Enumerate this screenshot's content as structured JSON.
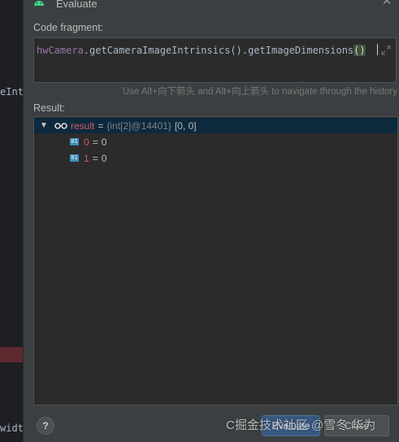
{
  "editor_background": {
    "fragment_1": "eInt",
    "fragment_2": "width"
  },
  "dialog": {
    "title": "Evaluate",
    "code_fragment_label": "Code fragment:",
    "code": {
      "receiver": "hwCamera",
      "call_1": "getCameraImageIntrinsics",
      "call_2": "getImageDimensions",
      "parens": "()"
    },
    "history_hint": "Use Alt+向下箭头 and Alt+向上箭头 to navigate through the history",
    "result_label": "Result:",
    "result": {
      "name": "result",
      "type_info": "{int[2]@14401}",
      "value": "[0, 0]",
      "children": [
        {
          "icon_text": "01",
          "name": "0",
          "value": "0"
        },
        {
          "icon_text": "01",
          "name": "1",
          "value": "0"
        }
      ]
    },
    "buttons": {
      "help": "?",
      "evaluate": "Evaluate",
      "close": "Close"
    },
    "watermark": "C掘金技术社区 @雪冬 华为"
  },
  "colors": {
    "selection": "#0d293e",
    "accent_button": "#365880",
    "variable_red": "#d45b5b",
    "android_green": "#3ddc84"
  }
}
